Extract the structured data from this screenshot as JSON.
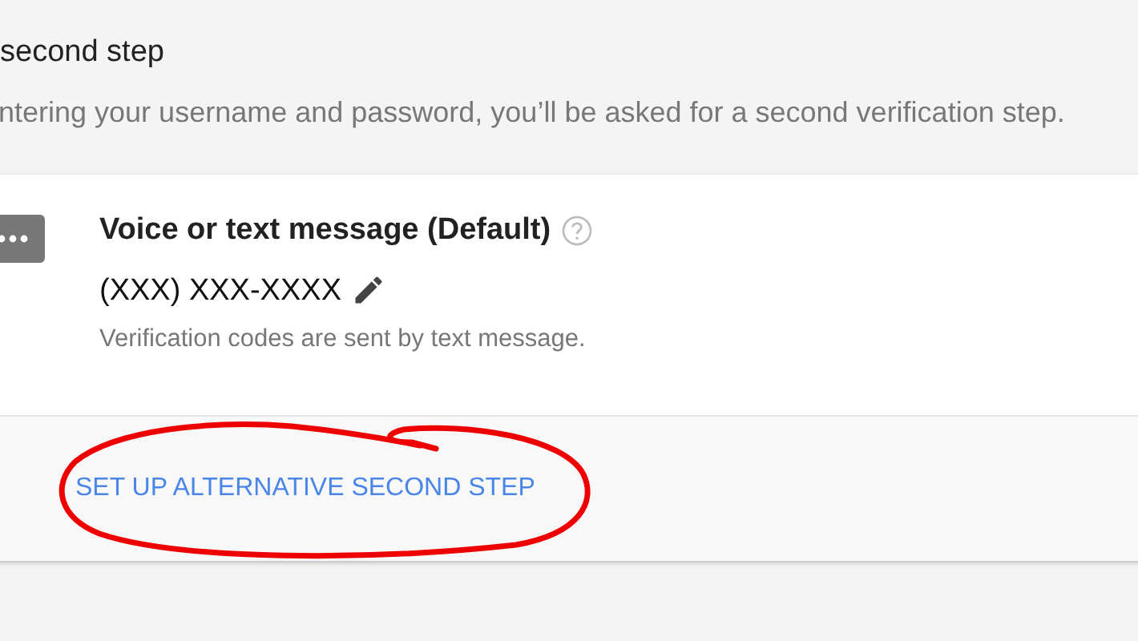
{
  "section": {
    "title": "second step",
    "description": "ntering your username and password, you’ll be asked for a second verification step."
  },
  "method": {
    "title": "Voice or text message (Default)",
    "phone": "(XXX) XXX-XXXX",
    "note": "Verification codes are sent by text message."
  },
  "footer": {
    "link": "SET UP ALTERNATIVE SECOND STEP",
    "circled": true
  }
}
